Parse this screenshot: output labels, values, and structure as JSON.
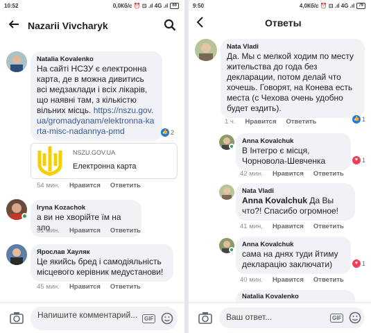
{
  "left": {
    "status": {
      "time": "10:52",
      "info": "0,0Кб/с ⏰ ⊡ .ıl 4G .ıl",
      "battery": "69"
    },
    "header": {
      "title": "Nazarii Vivcharyk"
    },
    "comments": [
      {
        "author": "Natalia Kovalenko",
        "text": "На сайті НСЗУ є електронна карта, де в можна дивитись всі медзаклади і всіх лікарів, що наявні там, з кількістю вільних місць.",
        "link": "https://nszu.gov.ua/gromadyanam/elektronna-karta-misc-nadannya-pmd",
        "reaction_count": "2",
        "time": "54 мин.",
        "like": "Нравится",
        "reply": "Ответить",
        "card": {
          "domain": "NSZU.GOV.UA",
          "title": "Електронна карта"
        }
      },
      {
        "author": "Iryna Kozachok",
        "text": "а ви не хворійте їм на зло",
        "time": "51 мин.",
        "like": "Нравится",
        "reply": "Ответить"
      },
      {
        "author": "Ярослав Хауляк",
        "text": "Це якийсь бред і самодіяльність місцевого керівник медустанови!",
        "time": "45 мин.",
        "like": "Нравится",
        "reply": "Ответить"
      }
    ],
    "input": {
      "placeholder": "Напишите комментарий...",
      "gif": "GIF"
    }
  },
  "right": {
    "status": {
      "time": "9:50",
      "info": "4,0Кб/с ⏰ ⊡ .ıl 4G .ıl",
      "battery": "79"
    },
    "header": {
      "title": "Ответы"
    },
    "comments": [
      {
        "author": "Nata Vladi",
        "text": "Да. Мы с мелкой ходим по месту жительства до года без декларации, потом делай что хочешь. Говорят, на Конева есть места (с Чехова очень удобно будет ездить).",
        "time": "1 ч.",
        "like": "Нравится",
        "reply": "Ответить",
        "reaction_count": "1"
      },
      {
        "author": "Anna Kovalchuk",
        "text": "В Інтегро є місця, Чорновола-Шевченка",
        "time": "42 мин.",
        "like": "Нравится",
        "reply": "Ответить",
        "reaction_count": "1"
      },
      {
        "author": "Nata Vladi",
        "mention": "Anna Kovalchuk",
        "text": "Да Вы что?! Спасибо огромное!",
        "time": "41 мин.",
        "like": "Нравится",
        "reply": "Ответить"
      },
      {
        "author": "Anna Kovalchuk",
        "text": "сама на днях туди йтиму декларацію заключати)",
        "time": "40 мин.",
        "like": "Нравится",
        "reply": "Ответить",
        "reaction_count": "1"
      },
      {
        "author": "Natalia Kovalenko"
      }
    ],
    "input": {
      "placeholder": "Ваш ответ...",
      "gif": "GIF"
    }
  },
  "colors": {
    "bubble": "#f0f2f5",
    "link": "#385898",
    "like_blue": "#1877f2",
    "heart_red": "#f33e58",
    "online": "#31a24c"
  },
  "icons": [
    "back-arrow-icon",
    "search-icon",
    "camera-icon",
    "gif-icon",
    "emoji-icon",
    "like-reaction-icon",
    "heart-reaction-icon"
  ]
}
